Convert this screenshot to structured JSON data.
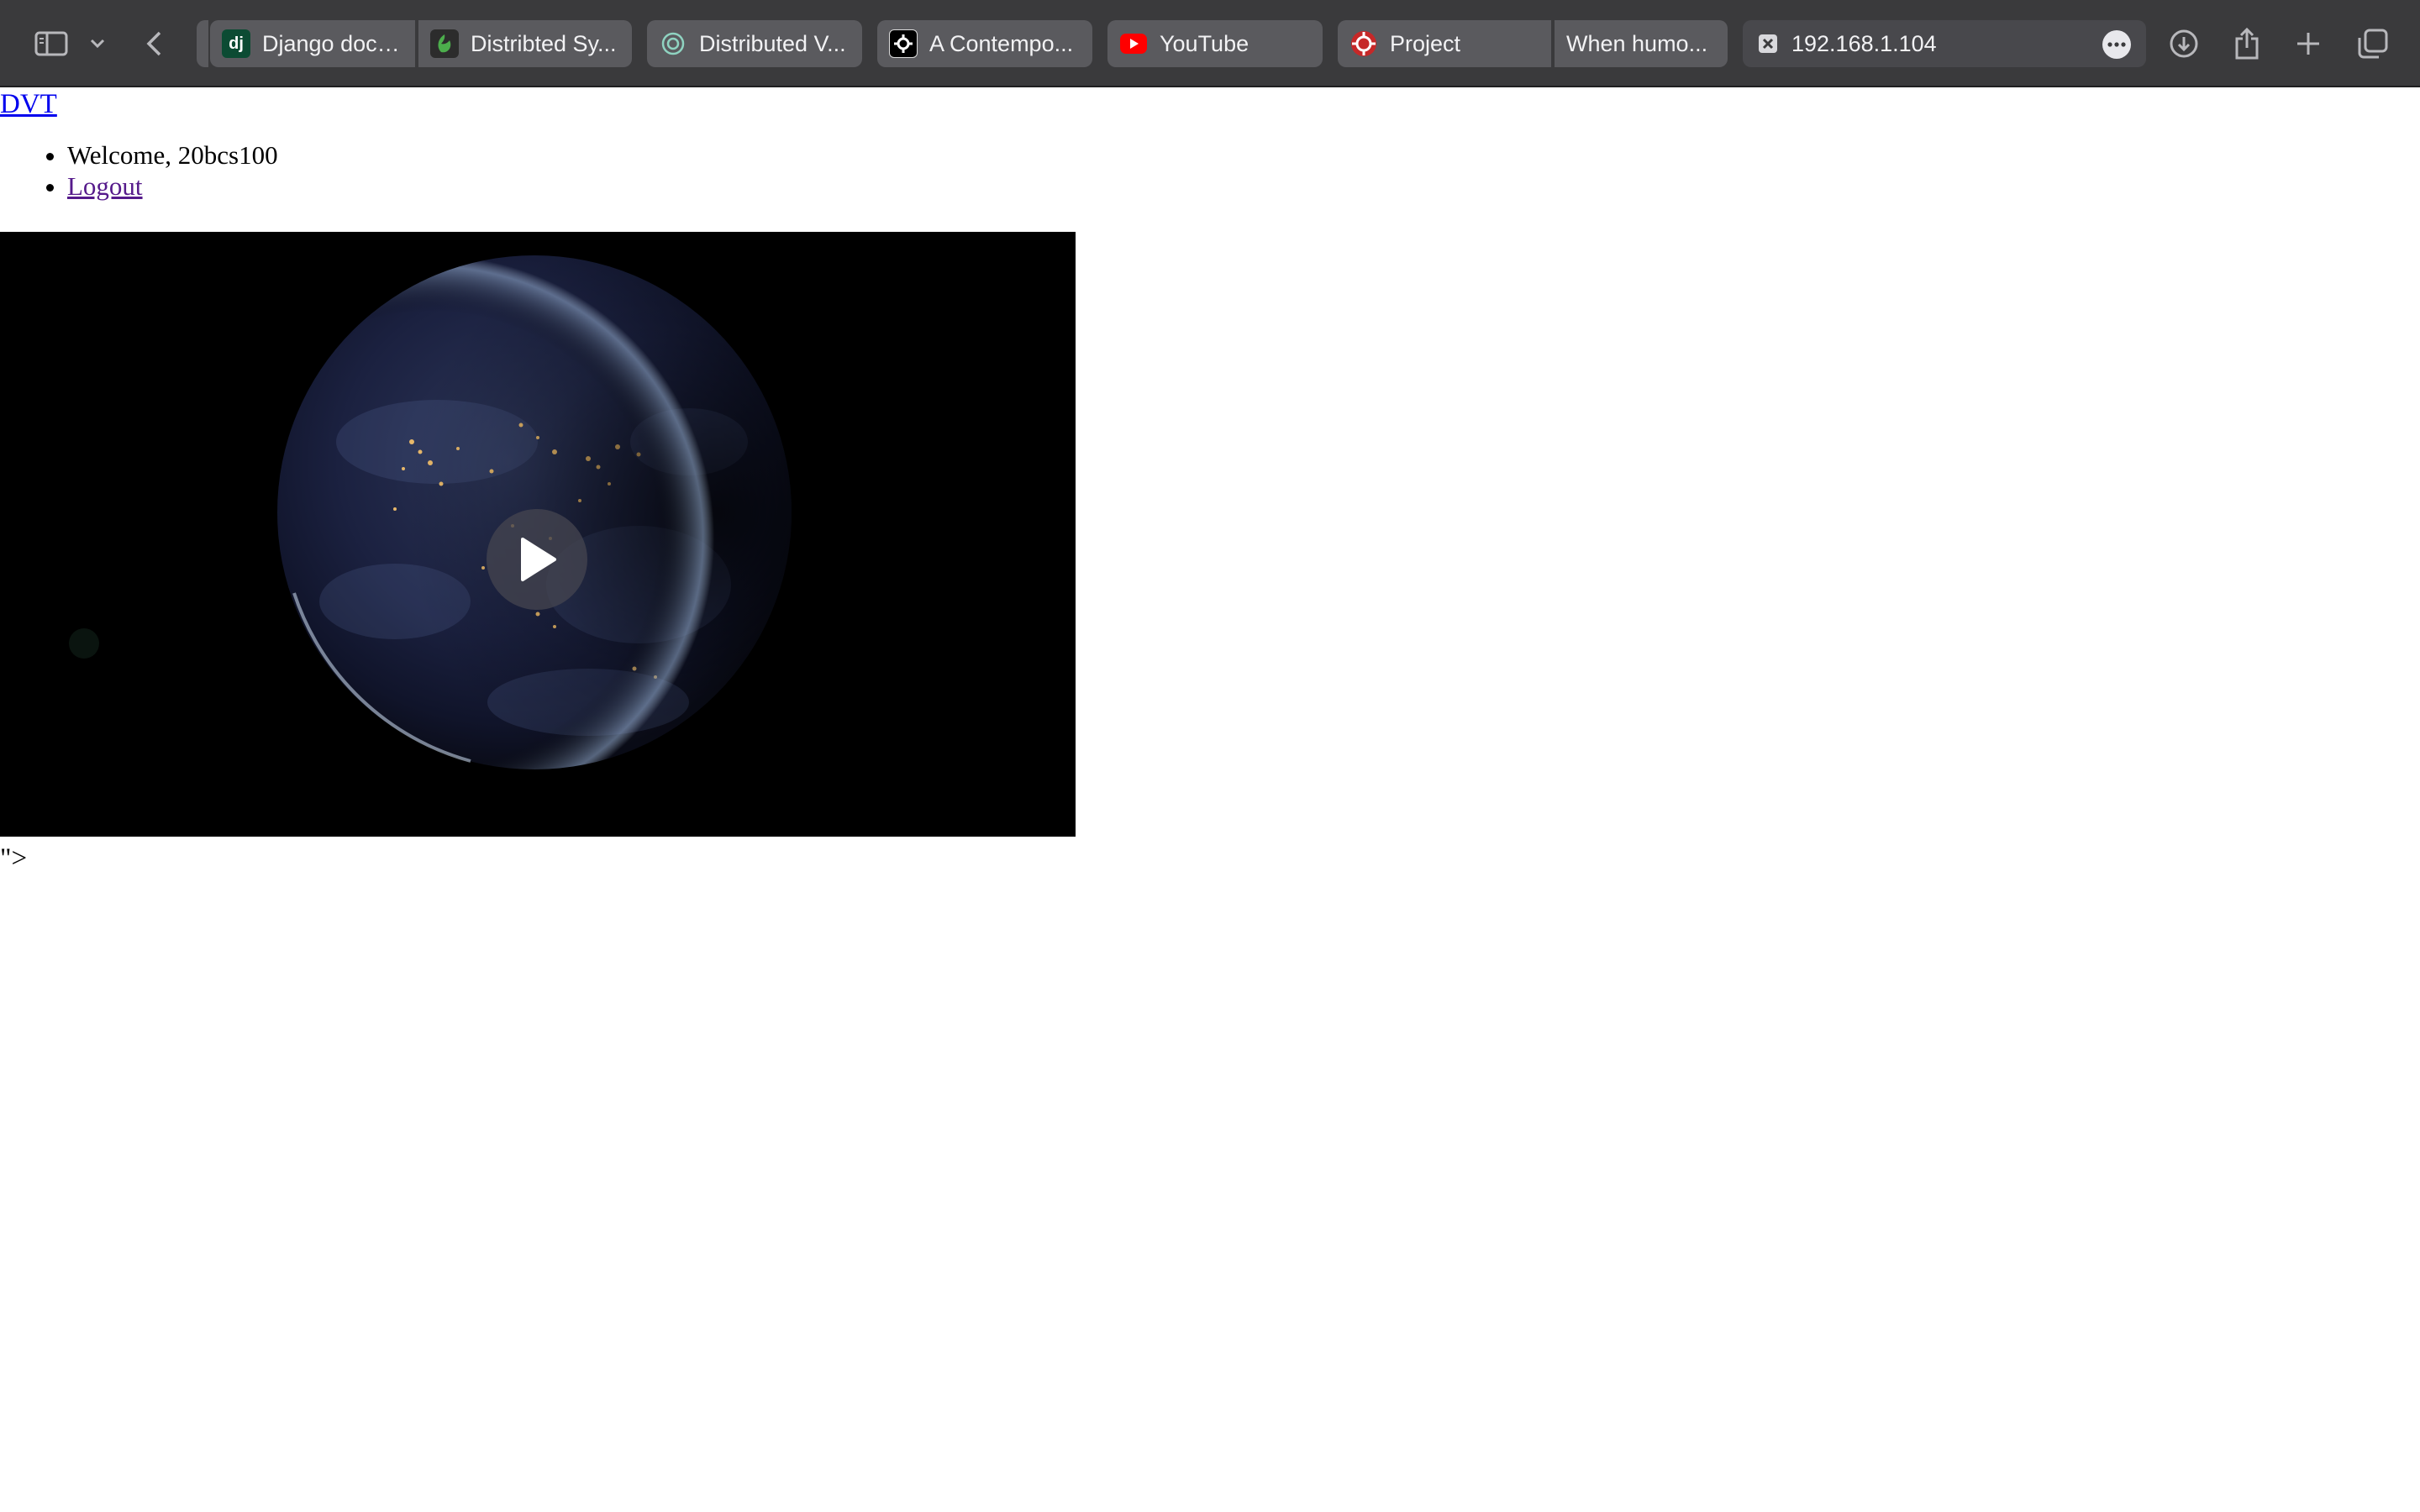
{
  "browser": {
    "tabs": [
      {
        "label": "Django docu...",
        "icon": "django-icon",
        "favicon_text": "dj"
      },
      {
        "label": "Distribted Sy...",
        "icon": "overleaf-icon"
      },
      {
        "label": "Distributed V...",
        "icon": "chatgpt-icon"
      },
      {
        "label": "A Contempo...",
        "icon": "gear-logo-icon"
      },
      {
        "label": "YouTube",
        "icon": "youtube-icon"
      },
      {
        "label": "Project",
        "icon": "project-icon"
      },
      {
        "label": "When humo...",
        "icon": ""
      },
      {
        "label": "192.168.1.104",
        "icon": "close-x-icon",
        "active": true
      }
    ],
    "colors": {
      "toolbar": "#3a3a3c",
      "tab": "#5a5a5e",
      "youtube_red": "#ff0000"
    }
  },
  "page": {
    "brand": "DVT",
    "nav": {
      "welcome": "Welcome, 20bcs100",
      "logout": "Logout"
    },
    "video": {
      "state": "paused",
      "poster": "night-earth-from-space"
    },
    "stray_text": "\">"
  }
}
